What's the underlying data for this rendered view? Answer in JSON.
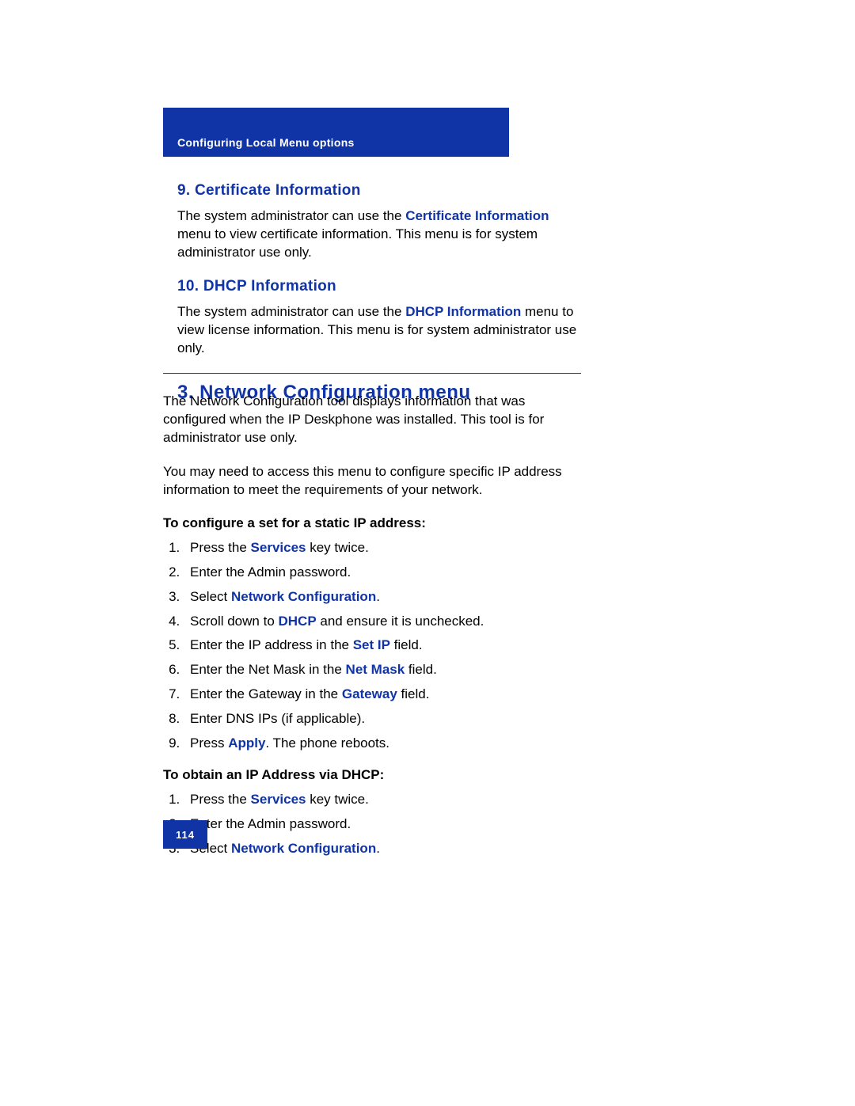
{
  "header": "Configuring Local Menu options",
  "section9": {
    "title": "9. Certificate Information",
    "text_pre": "The system administrator can use the ",
    "bold": "Certificate Information",
    "text_post": " menu to view certificate information. This menu is for system administrator use only."
  },
  "section10": {
    "title": "10. DHCP Information",
    "text_pre": "The system administrator can use the ",
    "bold": "DHCP Information",
    "text_post": " menu to view license information. This menu is for system administrator use only."
  },
  "main": {
    "title": "3. Network Configuration menu",
    "para1": "The Network Configuration tool displays information that was configured when the IP Deskphone was installed. This tool is for administrator use only.",
    "para2": "You may need to access this menu to configure specific IP address information to meet the requirements of your network.",
    "proc1_title": "To configure a set for a static IP address:",
    "proc1": {
      "s1a": "Press the ",
      "s1b": "Services",
      "s1c": " key twice.",
      "s2": "Enter the Admin password.",
      "s3a": "Select ",
      "s3b": "Network Configuration",
      "s3c": ".",
      "s4a": "Scroll down to ",
      "s4b": "DHCP",
      "s4c": " and ensure it is unchecked.",
      "s5a": "Enter the IP address in the ",
      "s5b": "Set IP",
      "s5c": " field.",
      "s6a": "Enter the Net Mask in the ",
      "s6b": "Net Mask",
      "s6c": " field.",
      "s7a": "Enter the Gateway in the ",
      "s7b": "Gateway",
      "s7c": " field.",
      "s8": "Enter DNS IPs (if applicable).",
      "s9a": "Press ",
      "s9b": "Apply",
      "s9c": ".  The phone reboots."
    },
    "proc2_title": "To obtain an IP Address via DHCP:",
    "proc2": {
      "s1a": "Press the ",
      "s1b": "Services",
      "s1c": " key twice.",
      "s2": "Enter the Admin password.",
      "s3a": "Select ",
      "s3b": "Network Configuration",
      "s3c": "."
    }
  },
  "page_number": "114"
}
